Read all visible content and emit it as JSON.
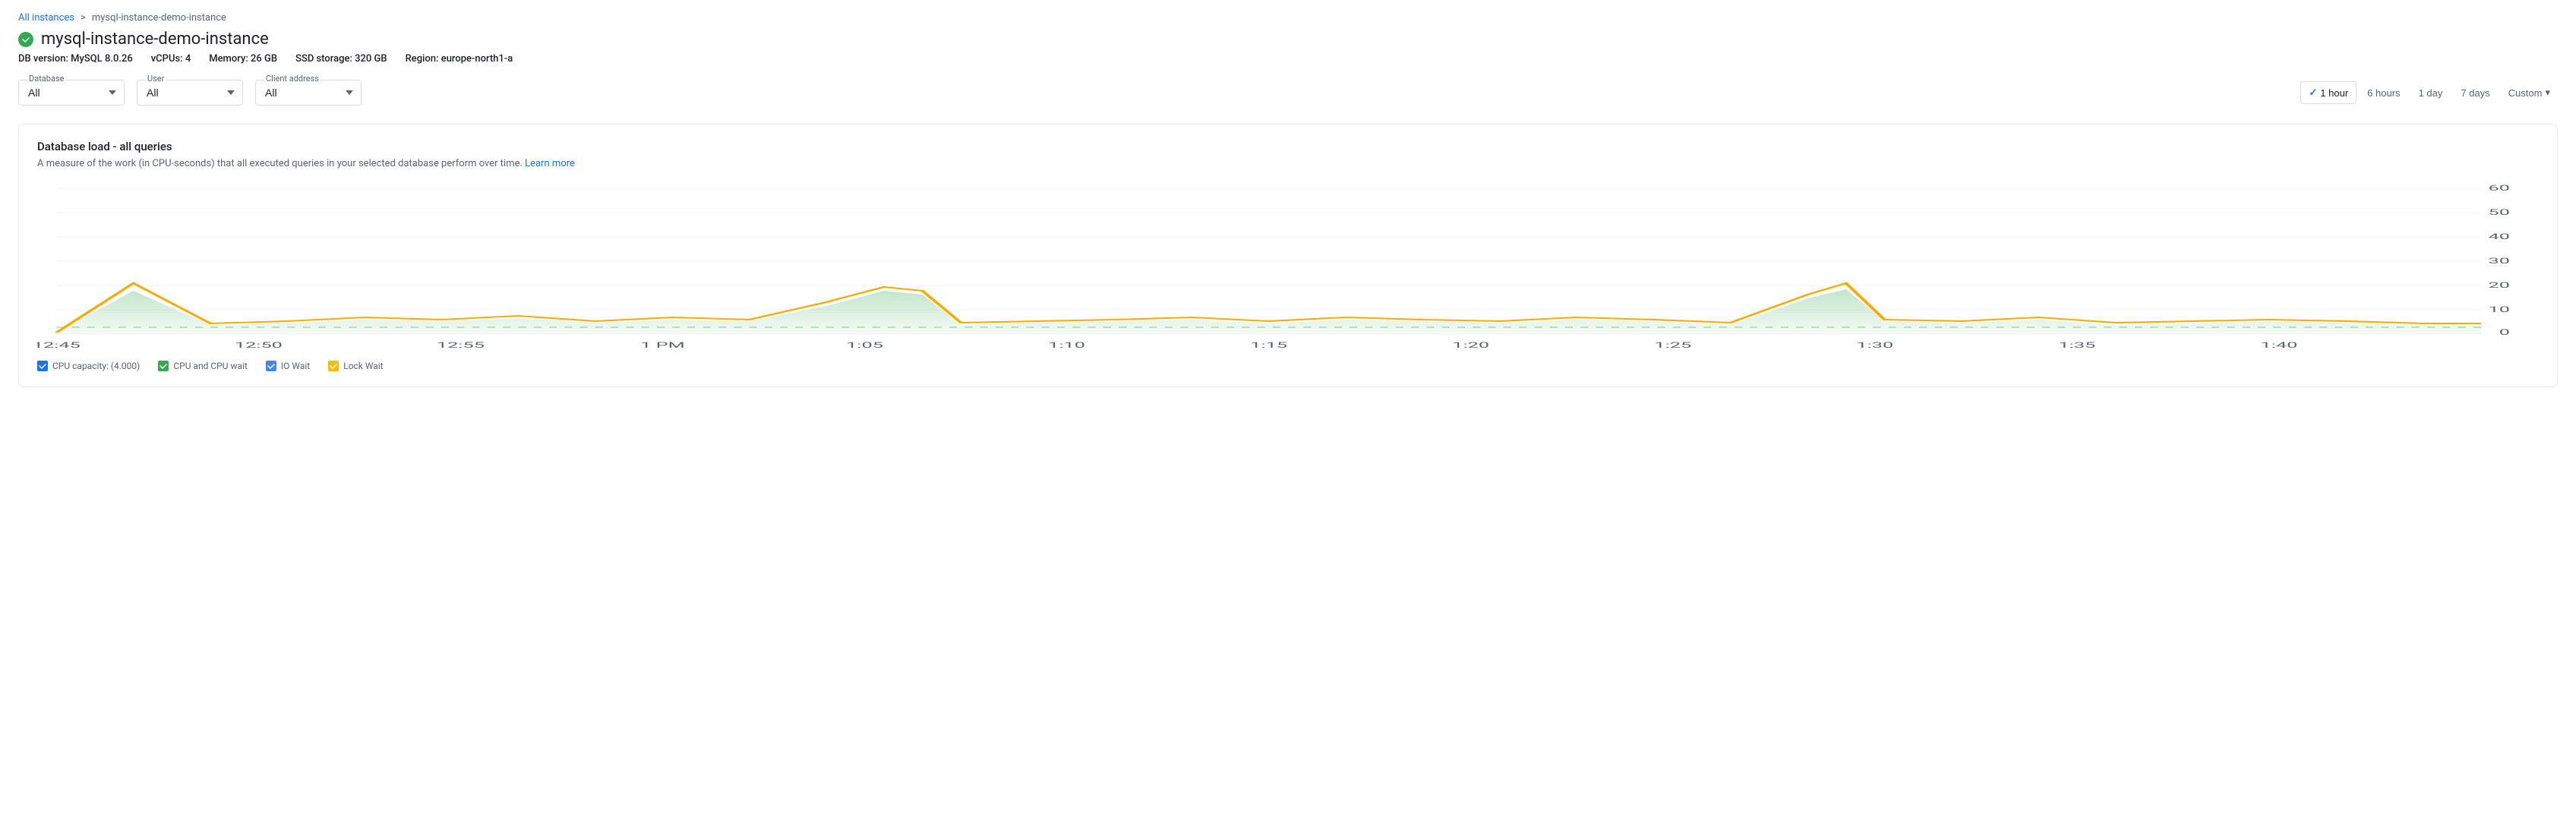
{
  "breadcrumb": {
    "parent_label": "All instances",
    "separator": ">",
    "current": "mysql-instance-demo-instance"
  },
  "page_title": "mysql-instance-demo-instance",
  "status": "healthy",
  "meta": {
    "db_version_label": "DB version:",
    "db_version_value": "MySQL 8.0.26",
    "vcpus_label": "vCPUs:",
    "vcpus_value": "4",
    "memory_label": "Memory:",
    "memory_value": "26 GB",
    "storage_label": "SSD storage:",
    "storage_value": "320 GB",
    "region_label": "Region:",
    "region_value": "europe-north1-a"
  },
  "filters": {
    "database": {
      "label": "Database",
      "value": "All",
      "options": [
        "All"
      ]
    },
    "user": {
      "label": "User",
      "value": "All",
      "options": [
        "All"
      ]
    },
    "client_address": {
      "label": "Client address",
      "value": "All",
      "options": [
        "All"
      ]
    }
  },
  "time_range": {
    "options": [
      "1 hour",
      "6 hours",
      "1 day",
      "7 days",
      "Custom"
    ],
    "active": "1 hour",
    "check_symbol": "✓"
  },
  "chart": {
    "title": "Database load - all queries",
    "subtitle": "A measure of the work (in CPU-seconds) that all executed queries in your selected database perform over time.",
    "learn_more": "Learn more",
    "y_axis_max": 60,
    "y_axis_labels": [
      "60",
      "50",
      "40",
      "30",
      "20",
      "10",
      "0"
    ],
    "x_axis_labels": [
      "12:45",
      "12:50",
      "12:55",
      "1 PM",
      "1:05",
      "1:10",
      "1:15",
      "1:20",
      "1:25",
      "1:30",
      "1:35",
      "1:40"
    ],
    "legend": [
      {
        "id": "cpu-capacity",
        "label": "CPU capacity: (4.000)",
        "color": "#1a73e8",
        "type": "checkbox"
      },
      {
        "id": "cpu-wait",
        "label": "CPU and CPU wait",
        "color": "#34a853",
        "type": "checkbox"
      },
      {
        "id": "io-wait",
        "label": "IO Wait",
        "color": "#4285f4",
        "type": "checkbox"
      },
      {
        "id": "lock-wait",
        "label": "Lock Wait",
        "color": "#fbbc04",
        "type": "checkbox"
      }
    ]
  }
}
